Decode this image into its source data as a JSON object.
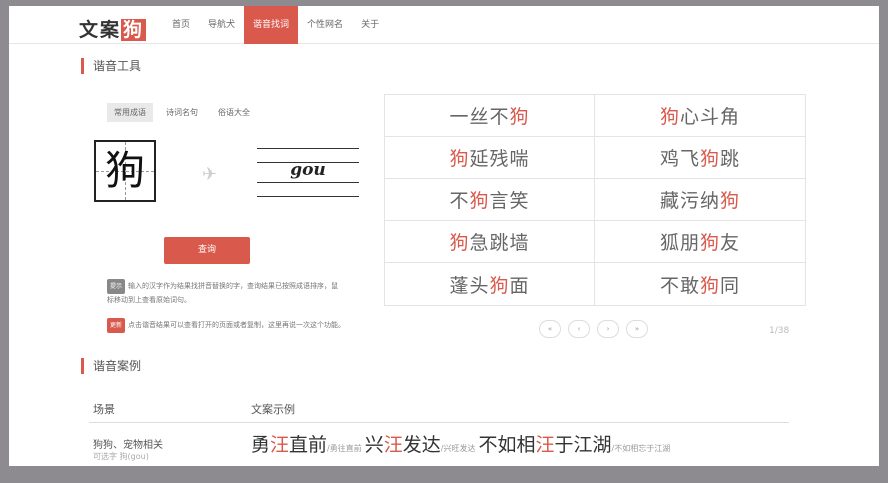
{
  "header": {
    "logo_prefix": "文案",
    "logo_highlight": "狗",
    "nav": [
      "首页",
      "导航犬",
      "谐音找词",
      "个性网名",
      "关于"
    ]
  },
  "tool": {
    "section_title": "谐音工具",
    "tabs": [
      "常用成语",
      "诗词名句",
      "俗语大全"
    ],
    "character": "狗",
    "pinyin": "gou",
    "query_label": "查询",
    "tip_badge": "提示",
    "tip_text_1": "输入的汉字作为结果找拼音替换的字，查询结果已按照成语排序，鼠",
    "tip_text_2": "标移动到上查看原始词句。",
    "update_badge": "更新",
    "update_text": "点击谐音结果可以查看打开的页面或者复制，这里再说一次这个功能。"
  },
  "results": [
    {
      "pre": "一丝不",
      "hit": "狗",
      "post": ""
    },
    {
      "pre": "",
      "hit": "狗",
      "post": "心斗角"
    },
    {
      "pre": "",
      "hit": "狗",
      "post": "延残喘"
    },
    {
      "pre": "鸡飞",
      "hit": "狗",
      "post": "跳"
    },
    {
      "pre": "不",
      "hit": "狗",
      "post": "言笑"
    },
    {
      "pre": "藏污纳",
      "hit": "狗",
      "post": ""
    },
    {
      "pre": "",
      "hit": "狗",
      "post": "急跳墙"
    },
    {
      "pre": "狐朋",
      "hit": "狗",
      "post": "友"
    },
    {
      "pre": "蓬头",
      "hit": "狗",
      "post": "面"
    },
    {
      "pre": "不敢",
      "hit": "狗",
      "post": "同"
    }
  ],
  "pager": {
    "first": "«",
    "prev": "‹",
    "next": "›",
    "last": "»",
    "count": "1/38"
  },
  "cases": {
    "section_title": "谐音案例",
    "col_scene": "场景",
    "col_example": "文案示例",
    "row_scene": "狗狗、宠物相关",
    "row_sub": "可选字  狗(gou)",
    "ex1_pre": "勇",
    "ex1_hit": "汪",
    "ex1_post": "直前",
    "ex1_orig": "/勇往直前",
    "ex2_pre": "兴",
    "ex2_hit": "汪",
    "ex2_post": "发达",
    "ex2_orig": "/兴旺发达",
    "ex3_pre": "不如相",
    "ex3_hit": "汪",
    "ex3_post": "于江湖",
    "ex3_orig": "/不如相忘于江湖"
  }
}
